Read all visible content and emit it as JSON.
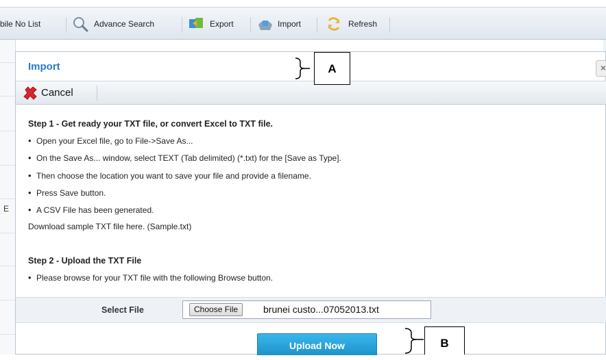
{
  "toolbar": {
    "items": [
      {
        "label": "bile No List"
      },
      {
        "label": "Advance Search",
        "icon": "magnifier-icon"
      },
      {
        "label": "Export",
        "icon": "export-icon"
      },
      {
        "label": "Import",
        "icon": "import-icon"
      },
      {
        "label": "Refresh",
        "icon": "refresh-icon"
      }
    ]
  },
  "left_column": {
    "cut_letter": "E"
  },
  "dialog": {
    "title": "Import",
    "close_glyph": "×",
    "cancel_label": "Cancel",
    "step1": {
      "heading": "Step 1 - Get ready your TXT file, or convert Excel to TXT file.",
      "bullets": [
        "Open your Excel file, go to File->Save As...",
        "On the Save As... window, select TEXT (Tab delimited) (*.txt) for the [Save as Type].",
        "Then choose the location you want to save your file and provide a filename.",
        "Press Save button.",
        "A CSV File has been generated."
      ],
      "download_text": "Download sample TXT file here. (Sample.txt)"
    },
    "step2": {
      "heading": "Step 2 - Upload the TXT File",
      "bullets": [
        "Please browse for your TXT file with the following Browse button."
      ]
    },
    "file": {
      "label": "Select File",
      "choose_button": "Choose File",
      "file_name": "brunei custo...07052013.txt"
    },
    "upload_button": "Upload Now"
  },
  "annotations": {
    "callout_a": "A",
    "callout_b": "B"
  },
  "colors": {
    "title_blue": "#2a79c4",
    "upload_button": "#2aa6de",
    "cancel_red": "#d9262b"
  }
}
